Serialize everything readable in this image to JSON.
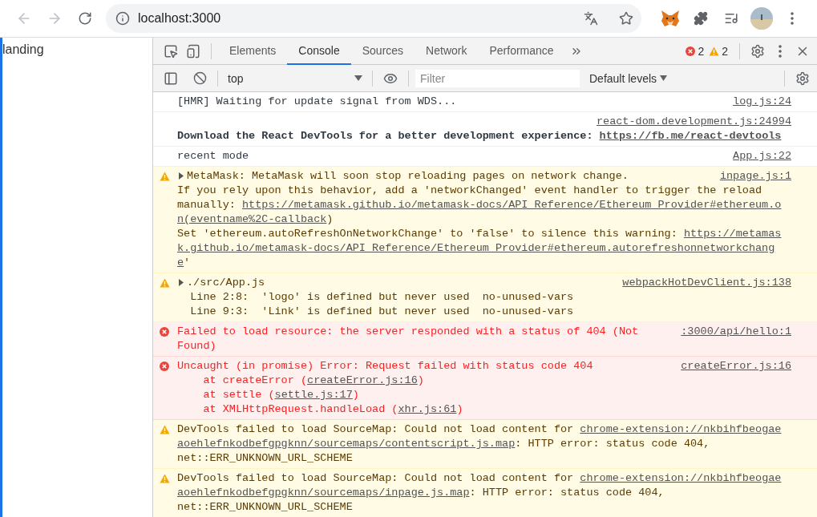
{
  "browser": {
    "address": "localhost:3000"
  },
  "page": {
    "text": "landing"
  },
  "devtools": {
    "tabs": [
      {
        "label": "Elements",
        "selected": false
      },
      {
        "label": "Console",
        "selected": true
      },
      {
        "label": "Sources",
        "selected": false
      },
      {
        "label": "Network",
        "selected": false
      },
      {
        "label": "Performance",
        "selected": false
      }
    ],
    "error_count": "2",
    "warning_count": "2"
  },
  "console_toolbar": {
    "context": "top",
    "filter": {
      "placeholder": "Filter"
    },
    "levels": "Default levels"
  },
  "messages": [
    {
      "kind": "info",
      "source": "log.js:24",
      "source_above": false,
      "bold": false,
      "lines": [
        [
          {
            "text": "[HMR] Waiting for update signal from WDS...",
            "kind": "text"
          }
        ]
      ]
    },
    {
      "kind": "info",
      "source": "react-dom.development.js:24994",
      "source_above": true,
      "bold": true,
      "lines": [
        [
          {
            "text": "Download the React DevTools for a better development experience: ",
            "kind": "text"
          },
          {
            "text": "https://fb.me/react-devtools",
            "kind": "link"
          }
        ]
      ]
    },
    {
      "kind": "info",
      "source": "App.js:22",
      "source_above": false,
      "bold": false,
      "lines": [
        [
          {
            "text": "recent mode",
            "kind": "text"
          }
        ]
      ]
    },
    {
      "kind": "warning",
      "source": "inpage.js:1",
      "source_above": false,
      "bold": false,
      "expanded": false,
      "lines": [
        [
          {
            "text": "MetaMask: MetaMask will soon stop reloading pages on network change.",
            "kind": "text"
          }
        ],
        [
          {
            "text": "If you rely upon this behavior, add a 'networkChanged' event handler to trigger the reload",
            "kind": "text"
          }
        ],
        [
          {
            "text": "manually: ",
            "kind": "text"
          },
          {
            "text": "https://metamask.github.io/metamask-docs/API_Reference/Ethereum_Provider#ethereum.o",
            "kind": "link"
          }
        ],
        [
          {
            "text": "n(eventname%2C-callback",
            "kind": "link"
          },
          {
            "text": ")",
            "kind": "text"
          }
        ],
        [
          {
            "text": "Set 'ethereum.autoRefreshOnNetworkChange' to 'false' to silence this warning: ",
            "kind": "text"
          },
          {
            "text": "https://metamas",
            "kind": "link"
          }
        ],
        [
          {
            "text": "k.github.io/metamask-docs/API_Reference/Ethereum_Provider#ethereum.autorefreshonnetworkchang",
            "kind": "link"
          }
        ],
        [
          {
            "text": "e",
            "kind": "link"
          },
          {
            "text": "'",
            "kind": "text"
          }
        ]
      ]
    },
    {
      "kind": "warning",
      "source": "webpackHotDevClient.js:138",
      "source_above": false,
      "bold": false,
      "expanded": false,
      "lines": [
        [
          {
            "text": "./src/App.js",
            "kind": "text"
          }
        ],
        [
          {
            "text": "  Line 2:8:  'logo' is defined but never used  no-unused-vars",
            "kind": "text"
          }
        ],
        [
          {
            "text": "  Line 9:3:  'Link' is defined but never used  no-unused-vars",
            "kind": "text"
          }
        ]
      ]
    },
    {
      "kind": "error",
      "source": ":3000/api/hello:1",
      "source_above": false,
      "bold": false,
      "lines": [
        [
          {
            "text": "Failed to load resource: the server responded with a status of 404 (Not",
            "kind": "text"
          }
        ],
        [
          {
            "text": "Found)",
            "kind": "text"
          }
        ]
      ]
    },
    {
      "kind": "error",
      "source": "createError.js:16",
      "source_above": false,
      "bold": false,
      "lines": [
        [
          {
            "text": "Uncaught (in promise) Error: Request failed with status code 404",
            "kind": "text"
          }
        ],
        [
          {
            "text": "    at createError (",
            "kind": "text"
          },
          {
            "text": "createError.js:16",
            "kind": "link"
          },
          {
            "text": ")",
            "kind": "text"
          }
        ],
        [
          {
            "text": "    at settle (",
            "kind": "text"
          },
          {
            "text": "settle.js:17",
            "kind": "link"
          },
          {
            "text": ")",
            "kind": "text"
          }
        ],
        [
          {
            "text": "    at XMLHttpRequest.handleLoad (",
            "kind": "text"
          },
          {
            "text": "xhr.js:61",
            "kind": "link"
          },
          {
            "text": ")",
            "kind": "text"
          }
        ]
      ]
    },
    {
      "kind": "warning",
      "source_above": false,
      "bold": false,
      "lines": [
        [
          {
            "text": "DevTools failed to load SourceMap: Could not load content for ",
            "kind": "text"
          },
          {
            "text": "chrome-extension://nkbihfbeogae",
            "kind": "link"
          }
        ],
        [
          {
            "text": "aoehlefnkodbefgpgknn/sourcemaps/contentscript.js.map",
            "kind": "link"
          },
          {
            "text": ": HTTP error: status code 404,",
            "kind": "text"
          }
        ],
        [
          {
            "text": "net::ERR_UNKNOWN_URL_SCHEME",
            "kind": "text"
          }
        ]
      ]
    },
    {
      "kind": "warning",
      "source_above": false,
      "bold": false,
      "lines": [
        [
          {
            "text": "DevTools failed to load SourceMap: Could not load content for ",
            "kind": "text"
          },
          {
            "text": "chrome-extension://nkbihfbeogae",
            "kind": "link"
          }
        ],
        [
          {
            "text": "aoehlefnkodbefgpgknn/sourcemaps/inpage.js.map",
            "kind": "link"
          },
          {
            "text": ": HTTP error: status code 404,",
            "kind": "text"
          }
        ],
        [
          {
            "text": "net::ERR_UNKNOWN_URL_SCHEME",
            "kind": "text"
          }
        ]
      ]
    }
  ]
}
